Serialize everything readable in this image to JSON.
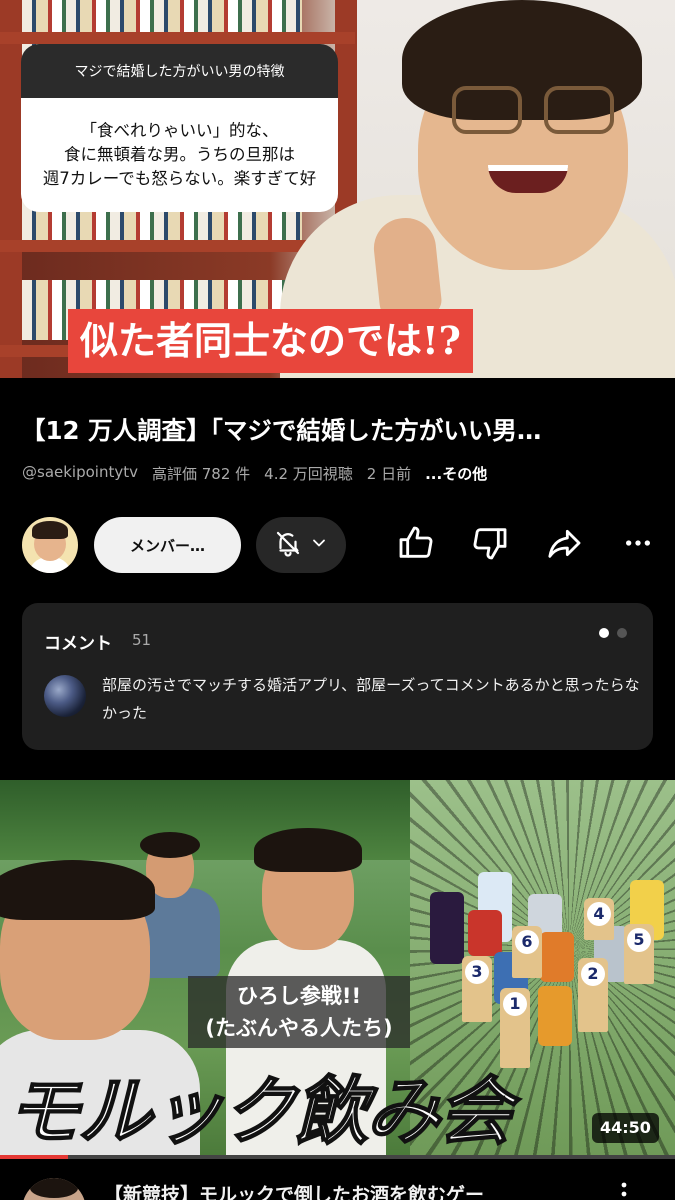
{
  "player": {
    "question_header": "マジで結婚した方がいい男の特徴",
    "question_body_line1": "「食べれりゃいい」的な、",
    "question_body_line2": "食に無頓着な男。うちの旦那は",
    "question_body_line3": "週7カレーでも怒らない。楽すぎて好",
    "caption": "似た者同士なのでは!?"
  },
  "video": {
    "title": "【12 万人調査】「マジで結婚した方がいい男…",
    "channel": "@saekipointytv",
    "likes": "高評価 782 件",
    "views": "4.2 万回視聴",
    "posted": "2 日前",
    "more": "...その他"
  },
  "actions": {
    "member_label": "メンバー…",
    "icons": [
      "bell-off-icon",
      "chevron-down-icon",
      "thumbs-up-icon",
      "thumbs-down-icon",
      "share-icon",
      "more-horizontal-icon"
    ]
  },
  "comments": {
    "title": "コメント",
    "count": "51",
    "text": "部屋の汚さでマッチする婚活アプリ、部屋ーズってコメントあるかと思ったらなかった"
  },
  "next_video": {
    "sub_caption_line1": "ひろし参戦!!",
    "sub_caption_line2": "(たぶんやる人たち)",
    "big_title": "モルック飲み会",
    "pin_numbers": [
      "4",
      "6",
      "5",
      "3",
      "2",
      "1"
    ],
    "duration": "44:50",
    "progress_fraction": 0.1,
    "title": "【新競技】モルックで倒したお酒を飲むゲー"
  },
  "colors": {
    "caption_red": "#e8463c",
    "progress_red": "#e53935",
    "card_dark": "#1f1f1f"
  }
}
